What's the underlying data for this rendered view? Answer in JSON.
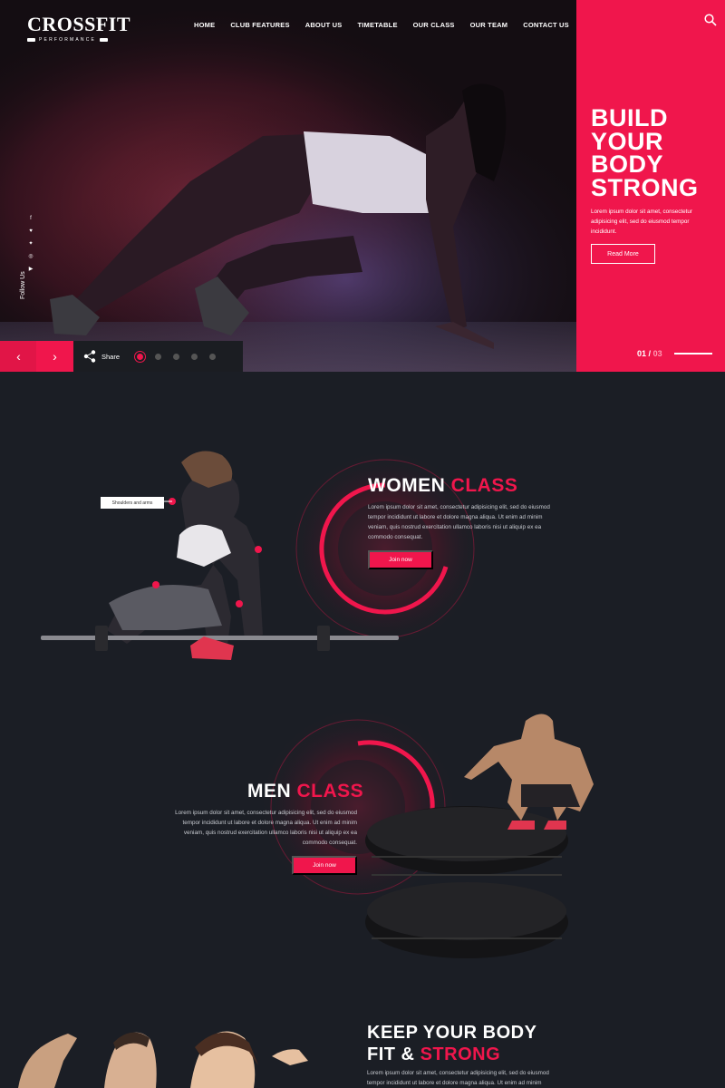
{
  "brand": {
    "name": "CROSSFIT",
    "tagline": "PERFORMANCE"
  },
  "nav": [
    "HOME",
    "CLUB FEATURES",
    "ABOUT US",
    "TIMETABLE",
    "OUR CLASS",
    "OUR TEAM",
    "CONTACT US"
  ],
  "hero": {
    "headline_lines": [
      "BUILD",
      "YOUR",
      "BODY",
      "STRONG"
    ],
    "text": "Lorem ipsum dolor sit amet, consectetur adipisicing elit, sed do eiusmod tempor incididunt.",
    "button": "Read More",
    "slide_current": "01",
    "slide_separator": "/",
    "slide_total": "03",
    "follow": "Follow Us",
    "share": "Share",
    "prev_icon": "‹",
    "next_icon": "›",
    "dots": 5,
    "active_dot": 0
  },
  "women": {
    "title_white": "WOMEN",
    "title_accent": "CLASS",
    "text": "Lorem ipsum dolor sit amet, consectetur adipisicing elit, sed do eiusmod tempor incididunt ut labore et dolore magna aliqua. Ut enim ad minim veniam, quis nostrud exercitation ullamco laboris nisi ut aliquip ex ea commodo consequat.",
    "button": "Join now",
    "tooltip": "Shoulders and arms"
  },
  "men": {
    "title_white": "MEN",
    "title_accent": "CLASS",
    "text": "Lorem ipsum dolor sit amet, consectetur adipisicing elit, sed do eiusmod tempor incididunt ut labore et dolore magna aliqua. Ut enim ad minim veniam, quis nostrud exercitation ullamco laboris nisi ut aliquip ex ea commodo consequat.",
    "button": "Join now"
  },
  "keepfit": {
    "line1": "KEEP YOUR BODY",
    "line2_white": "FIT &",
    "line2_accent": "STRONG",
    "text": "Lorem ipsum dolor sit amet, consectetur adipisicing elit, sed do eiusmod tempor incididunt ut labore et dolore magna aliqua. Ut enim ad minim"
  },
  "colors": {
    "accent": "#f0164c",
    "dark": "#1b1e25"
  }
}
